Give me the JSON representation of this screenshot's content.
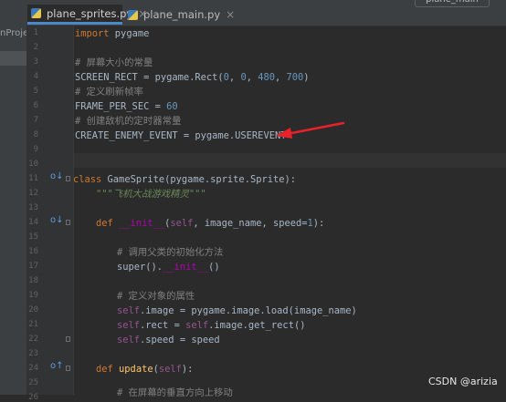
{
  "tabs": [
    {
      "label": "plane_sprites.py",
      "active": true
    },
    {
      "label": "plane_main.py",
      "active": false
    }
  ],
  "run_widget_label": "plane_main",
  "project_panel_label": "nProje",
  "line_numbers": [
    "1",
    "2",
    "3",
    "4",
    "5",
    "6",
    "7",
    "8",
    "9",
    "10",
    "11",
    "12",
    "13",
    "14",
    "15",
    "16",
    "17",
    "18",
    "19",
    "20",
    "21",
    "22",
    "23",
    "24",
    "25",
    "26"
  ],
  "code": {
    "l1_kw": "import",
    "l1_rest": " pygame",
    "l3": "# 屏幕大小的常量",
    "l4_a": "SCREEN_RECT = pygame.Rect(",
    "l4_n1": "0",
    "l4_s1": ", ",
    "l4_n2": "0",
    "l4_s2": ", ",
    "l4_n3": "480",
    "l4_s3": ", ",
    "l4_n4": "700",
    "l4_end": ")",
    "l5": "# 定义刷新帧率",
    "l6_a": "FRAME_PER_SEC = ",
    "l6_n": "60",
    "l7": "# 创建敌机的定时器常量",
    "l8": "CREATE_ENEMY_EVENT = pygame.USEREVENT",
    "l11_kw": "class",
    "l11_sp": " ",
    "l11_name": "GameSprite",
    "l11_rest": "(pygame.sprite.Sprite):",
    "l12": "\"\"\"飞机大战游戏精灵\"\"\"",
    "l14_kw": "def",
    "l14_sp": " ",
    "l14_fn": "__init__",
    "l14_a": "(",
    "l14_self": "self",
    "l14_b": ", image_name, speed=",
    "l14_n": "1",
    "l14_c": "):",
    "l16": "# 调用父类的初始化方法",
    "l17_a": "super().",
    "l17_m": "__init__",
    "l17_b": "()",
    "l19": "# 定义对象的属性",
    "l20_self": "self",
    "l20_rest": ".image = pygame.image.load(image_name)",
    "l21_self": "self",
    "l21_b": ".rect = ",
    "l21_self2": "self",
    "l21_c": ".image.get_rect()",
    "l22_self": "self",
    "l22_rest": ".speed = speed",
    "l24_kw": "def",
    "l24_sp": " ",
    "l24_fn": "update",
    "l24_a": "(",
    "l24_self": "self",
    "l24_b": "):",
    "l26": "# 在屏幕的垂直方向上移动"
  },
  "gutter_icons": {
    "override_marker": "o↓",
    "override_up_marker": "o↑",
    "bookmark_marker": "o↑",
    "override_gutter_icon": "override-marker-icon"
  },
  "annotation": {
    "arrow_color": "#e8212b"
  },
  "watermark": "CSDN @arizia"
}
